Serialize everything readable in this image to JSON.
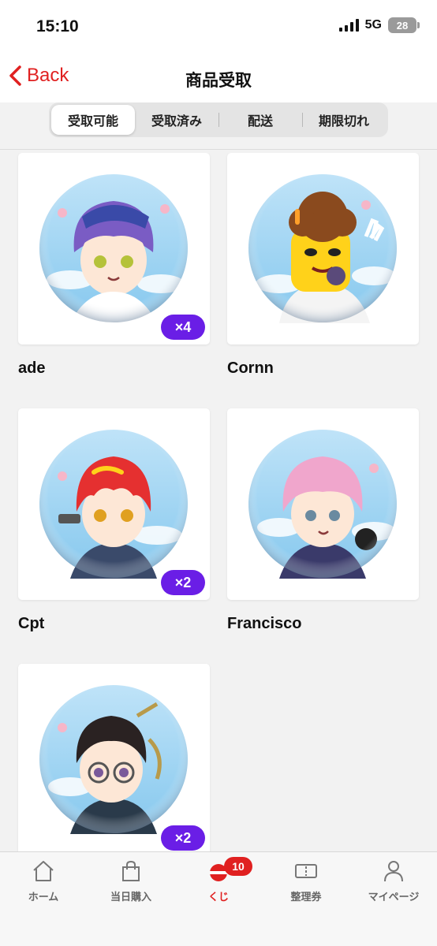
{
  "status_bar": {
    "time": "15:10",
    "network": "5G",
    "battery": "28"
  },
  "header": {
    "back_label": "Back",
    "title": "商品受取"
  },
  "segments": [
    {
      "label": "受取可能",
      "active": true
    },
    {
      "label": "受取済み",
      "active": false
    },
    {
      "label": "配送",
      "active": false
    },
    {
      "label": "期限切れ",
      "active": false
    }
  ],
  "items": [
    {
      "name": "ade",
      "quantity": "×4",
      "hair_color": "#7a5cc4"
    },
    {
      "name": "Cornn",
      "quantity": "",
      "hair_color": "#8a4a1e"
    },
    {
      "name": "Cpt",
      "quantity": "×2",
      "hair_color": "#e53030"
    },
    {
      "name": "Francisco",
      "quantity": "",
      "hair_color": "#f0a6cc"
    },
    {
      "name": "",
      "quantity": "×2",
      "hair_color": "#2a2222"
    }
  ],
  "tab_bar": {
    "tabs": [
      {
        "label": "ホーム",
        "icon": "home-icon"
      },
      {
        "label": "当日購入",
        "icon": "shopping-bag-icon"
      },
      {
        "label": "くじ",
        "icon": "lottery-icon",
        "badge": "10",
        "active": true
      },
      {
        "label": "整理券",
        "icon": "ticket-icon"
      },
      {
        "label": "マイページ",
        "icon": "person-icon"
      }
    ]
  },
  "colors": {
    "accent": "#e02020",
    "quantity_badge": "#6a1ee6",
    "badge_sky": "#9fd3f2"
  }
}
